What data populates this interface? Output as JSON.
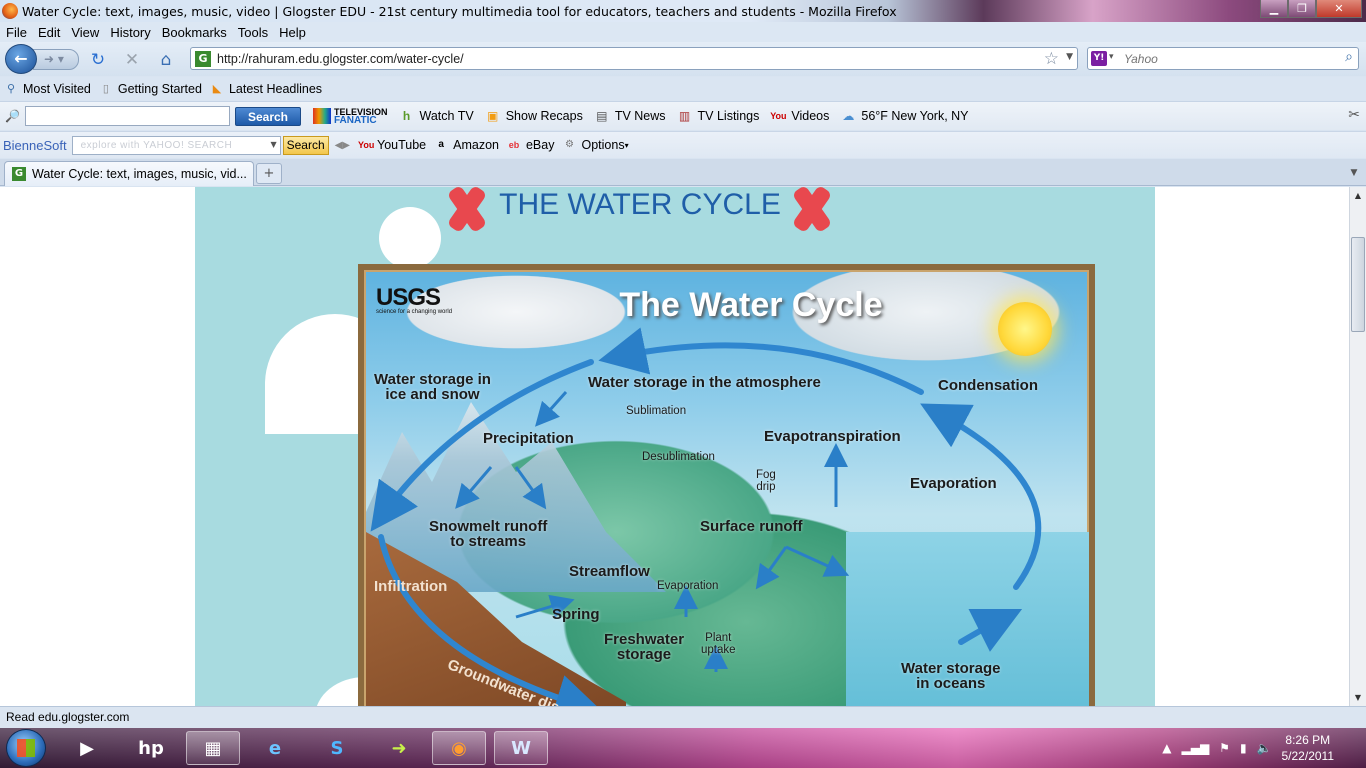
{
  "window": {
    "title": "Water Cycle: text, images, music, video | Glogster EDU - 21st century multimedia tool for educators, teachers and students - Mozilla Firefox"
  },
  "menu": [
    "File",
    "Edit",
    "View",
    "History",
    "Bookmarks",
    "Tools",
    "Help"
  ],
  "nav": {
    "url": "http://rahuram.edu.glogster.com/water-cycle/",
    "search_placeholder": "Yahoo"
  },
  "bookmarks": [
    "Most Visited",
    "Getting Started",
    "Latest Headlines"
  ],
  "toolbar1": {
    "search_button": "Search",
    "brand_top": "TELEVISION",
    "brand_bottom": "FANATIC",
    "items": [
      "Watch TV",
      "Show Recaps",
      "TV News",
      "TV Listings",
      "Videos",
      "56°F New York, NY"
    ]
  },
  "toolbar2": {
    "brand": "BienneSoft",
    "search_placeholder": "explore with YAHOO! SEARCH",
    "search_button": "Search",
    "items": [
      "YouTube",
      "Amazon",
      "eBay",
      "Options"
    ]
  },
  "tab": {
    "title": "Water Cycle: text, images, music, vid..."
  },
  "page": {
    "heading": "THE WATER CYCLE",
    "diagram": {
      "title": "The Water Cycle",
      "logo": "USGS",
      "logo_tag": "science for a changing world",
      "labels": {
        "ice_snow_1": "Water storage in",
        "ice_snow_2": "ice and snow",
        "atmosphere": "Water storage in the atmosphere",
        "condensation": "Condensation",
        "sublimation": "Sublimation",
        "desublimation": "Desublimation",
        "precipitation": "Precipitation",
        "evapotranspiration": "Evapotranspiration",
        "evaporation": "Evaporation",
        "fog_1": "Fog",
        "fog_2": "drip",
        "snowmelt_1": "Snowmelt runoff",
        "snowmelt_2": "to streams",
        "surface_runoff": "Surface runoff",
        "streamflow": "Streamflow",
        "evaporation_small": "Evaporation",
        "infiltration": "Infiltration",
        "spring": "Spring",
        "freshwater_1": "Freshwater",
        "freshwater_2": "storage",
        "plant_1": "Plant",
        "plant_2": "uptake",
        "oceans_1": "Water storage",
        "oceans_2": "in oceans",
        "groundwater": "Groundwater discharge"
      }
    }
  },
  "status": "Read edu.glogster.com",
  "clock": {
    "time": "8:26 PM",
    "date": "5/22/2011"
  }
}
